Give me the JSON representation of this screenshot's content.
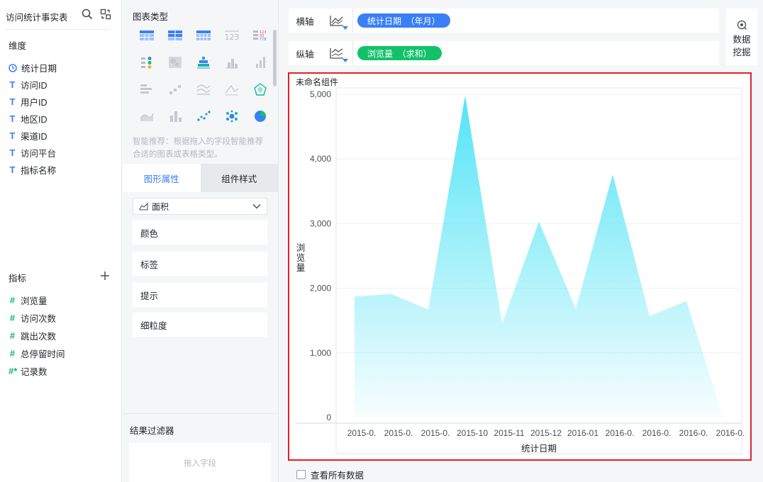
{
  "left": {
    "dataset_title": "访问统计事实表",
    "dimension_label": "维度",
    "dimensions": [
      {
        "label": "统计日期",
        "icon": "clock-icon"
      },
      {
        "label": "访问ID",
        "icon": "text-type-icon"
      },
      {
        "label": "用户ID",
        "icon": "text-type-icon"
      },
      {
        "label": "地区ID",
        "icon": "text-type-icon"
      },
      {
        "label": "渠道ID",
        "icon": "text-type-icon"
      },
      {
        "label": "访问平台",
        "icon": "text-type-icon"
      },
      {
        "label": "指标名称",
        "icon": "text-type-icon"
      }
    ],
    "measure_label": "指标",
    "measures": [
      {
        "label": "浏览量"
      },
      {
        "label": "访问次数"
      },
      {
        "label": "跳出次数"
      },
      {
        "label": "总停留时间"
      },
      {
        "label": "记录数"
      }
    ]
  },
  "middle": {
    "chart_type_title": "图表类型",
    "hint": "智能推荐：根据拖入的字段智能推荐合适的图表或表格类型。",
    "tabs": [
      "图形属性",
      "组件样式"
    ],
    "chart_select": "面积",
    "properties": [
      "颜色",
      "标签",
      "提示",
      "细粒度"
    ],
    "filter_title": "结果过滤器",
    "drop_placeholder": "拖入字段"
  },
  "axes": {
    "x_label": "横轴",
    "x_field": "统计日期  （年月）",
    "y_label": "纵轴",
    "y_field": "浏览量  （求和）"
  },
  "data_mining": "数据挖掘",
  "component_title": "未命名组件",
  "view_all": "查看所有数据",
  "colors": {
    "accent": "#3a7ff6",
    "measure": "#12c26b",
    "area_top": "#52e4f6",
    "highlight": "#e0212b"
  },
  "chart_data": {
    "type": "area",
    "xlabel": "统计日期",
    "ylabel": "浏览量",
    "ylim": [
      0,
      5000
    ],
    "yticks": [
      "0",
      "1,000",
      "2,000",
      "3,000",
      "4,000",
      "5,000"
    ],
    "categories": [
      "2015-0.",
      "2015-0.",
      "2015-0.",
      "2015-10",
      "2015-11",
      "2015-12",
      "2016-01",
      "2016-0.",
      "2016-0.",
      "2016-0.",
      "2016-0."
    ],
    "values": [
      1870,
      1910,
      1670,
      4980,
      1450,
      3030,
      1680,
      3760,
      1570,
      1800,
      0
    ],
    "grid": true,
    "legend": "none"
  }
}
